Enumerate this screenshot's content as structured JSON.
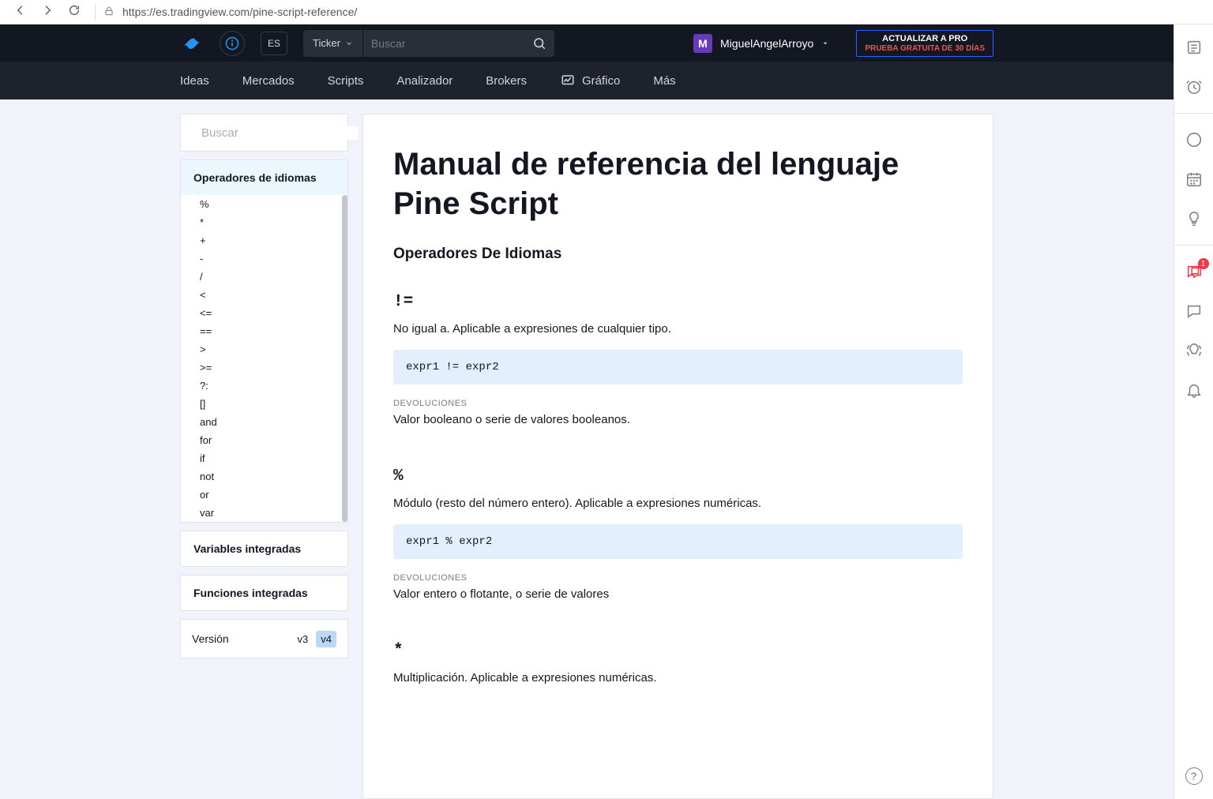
{
  "browser": {
    "url": "https://es.tradingview.com/pine-script-reference/"
  },
  "topbar": {
    "lang": "ES",
    "ticker_label": "Ticker",
    "search_placeholder": "Buscar",
    "username": "MiguelAngelArroyo",
    "avatar_letter": "M",
    "upgrade_line1": "ACTUALIZAR A PRO",
    "upgrade_line2": "PRUEBA GRATUITA DE 30 DÍAS"
  },
  "nav": {
    "ideas": "Ideas",
    "mercados": "Mercados",
    "scripts": "Scripts",
    "analizador": "Analizador",
    "brokers": "Brokers",
    "grafico": "Gráfico",
    "mas": "Más"
  },
  "sidebar": {
    "search_placeholder": "Buscar",
    "section_operators": "Operadores de idiomas",
    "operators": [
      "%",
      "*",
      "+",
      "-",
      "/",
      "<",
      "<=",
      "==",
      ">",
      ">=",
      "?:",
      "[]",
      "and",
      "for",
      "if",
      "not",
      "or",
      "var"
    ],
    "section_variables": "Variables integradas",
    "section_functions": "Funciones integradas",
    "version_label": "Versión",
    "v3": "v3",
    "v4": "v4"
  },
  "doc": {
    "title": "Manual de referencia del lenguaje Pine Script",
    "section_title": "Operadores De Idiomas",
    "returns_label": "DEVOLUCIONES",
    "entries": [
      {
        "sym": "!=",
        "desc": "No igual a. Aplicable a expresiones de cualquier tipo.",
        "code": "expr1 != expr2",
        "ret": "Valor booleano o serie de valores booleanos."
      },
      {
        "sym": "%",
        "desc": "Módulo (resto del número entero). Aplicable a expresiones numéricas.",
        "code": "expr1 % expr2",
        "ret": "Valor entero o flotante, o serie de valores"
      },
      {
        "sym": "*",
        "desc": "Multiplicación. Aplicable a expresiones numéricas.",
        "code": "",
        "ret": ""
      }
    ]
  },
  "rail": {
    "chat_badge": "1",
    "help": "?"
  }
}
